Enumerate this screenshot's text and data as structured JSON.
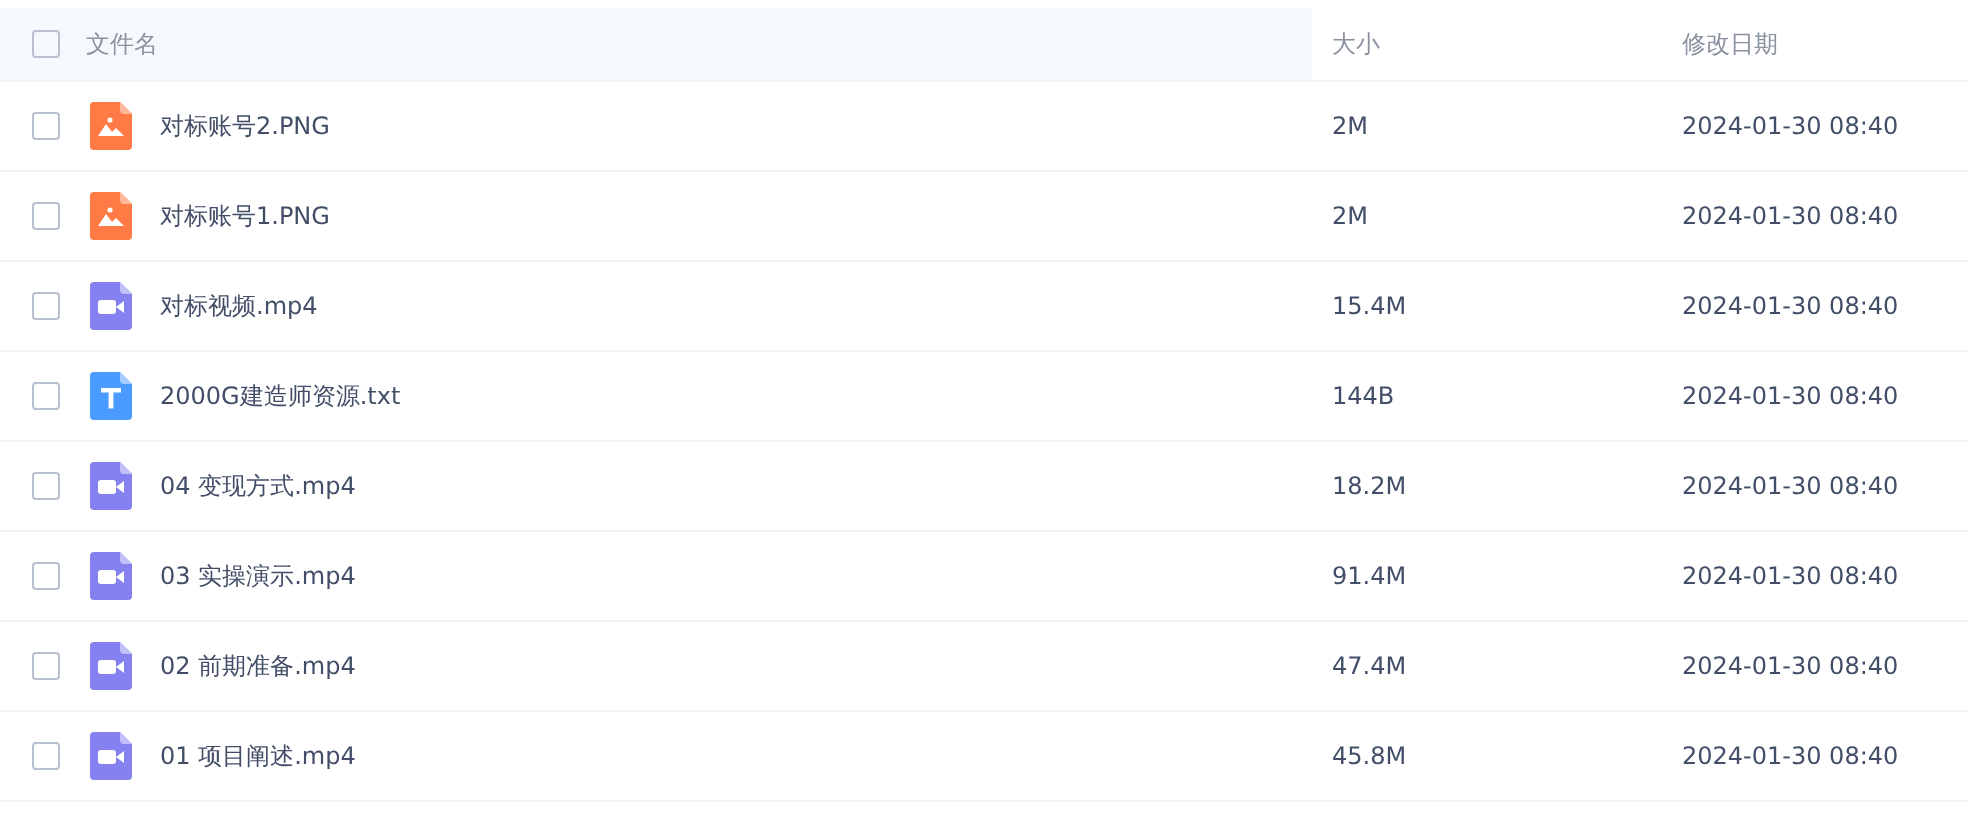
{
  "table": {
    "columns": [
      "文件名",
      "大小",
      "修改日期"
    ],
    "header_checked": false,
    "rows": [
      {
        "kind": "image",
        "name": "对标账号2.PNG",
        "size": "2M",
        "modified": "2024-01-30 08:40",
        "checked": false
      },
      {
        "kind": "image",
        "name": "对标账号1.PNG",
        "size": "2M",
        "modified": "2024-01-30 08:40",
        "checked": false
      },
      {
        "kind": "video",
        "name": "对标视频.mp4",
        "size": "15.4M",
        "modified": "2024-01-30 08:40",
        "checked": false
      },
      {
        "kind": "text",
        "name": "2000G建造师资源.txt",
        "size": "144B",
        "modified": "2024-01-30 08:40",
        "checked": false
      },
      {
        "kind": "video",
        "name": "04 变现方式.mp4",
        "size": "18.2M",
        "modified": "2024-01-30 08:40",
        "checked": false
      },
      {
        "kind": "video",
        "name": "03 实操演示.mp4",
        "size": "91.4M",
        "modified": "2024-01-30 08:40",
        "checked": false
      },
      {
        "kind": "video",
        "name": "02 前期准备.mp4",
        "size": "47.4M",
        "modified": "2024-01-30 08:40",
        "checked": false
      },
      {
        "kind": "video",
        "name": "01 项目阐述.mp4",
        "size": "45.8M",
        "modified": "2024-01-30 08:40",
        "checked": false
      }
    ]
  }
}
